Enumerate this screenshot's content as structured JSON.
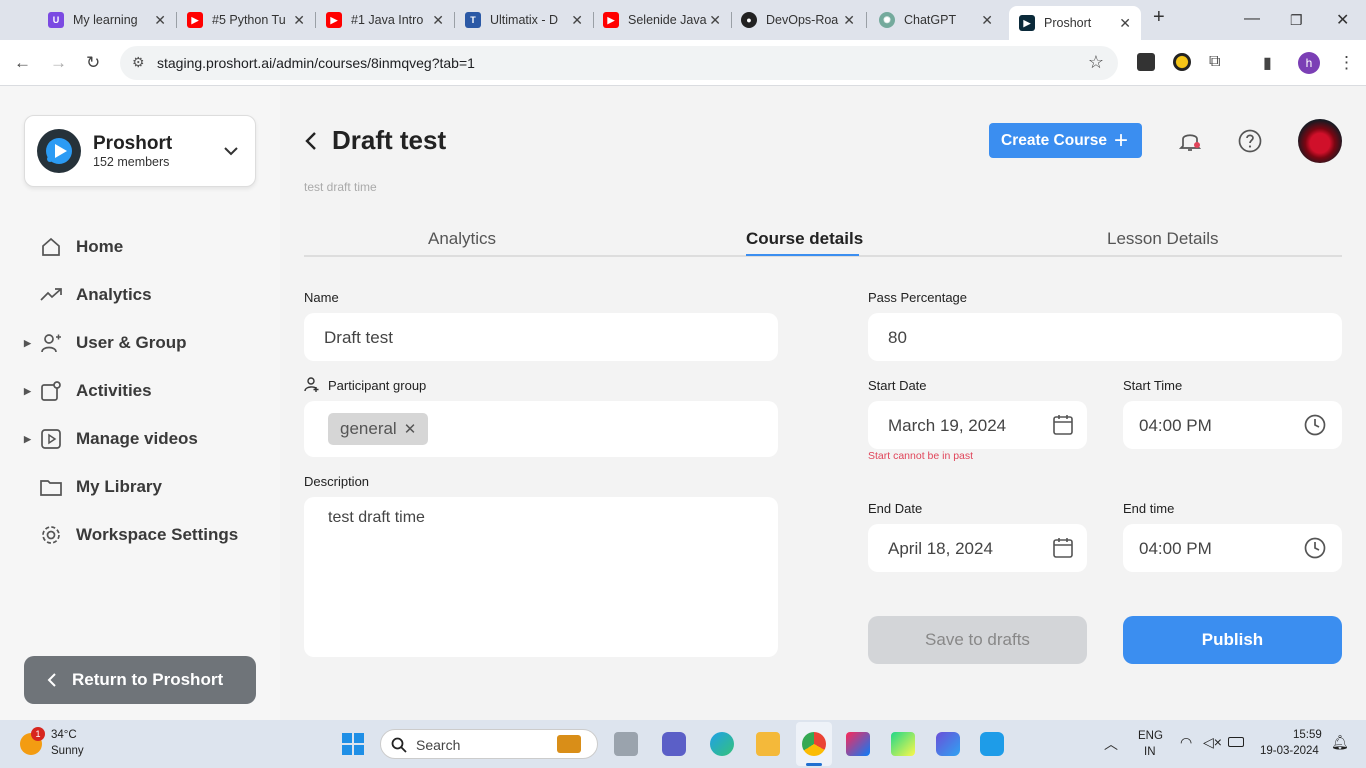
{
  "browser": {
    "tabs": [
      {
        "title": "My learning",
        "color": "#7b4ae2"
      },
      {
        "title": "#5 Python Tu",
        "color": "#ff0000"
      },
      {
        "title": "#1 Java Intro",
        "color": "#ff0000"
      },
      {
        "title": "Ultimatix - D",
        "color": "#2b59a6"
      },
      {
        "title": "Selenide Java",
        "color": "#ff0000"
      },
      {
        "title": "DevOps-Roa",
        "color": "#222222"
      },
      {
        "title": "ChatGPT",
        "color": "#74aa9c"
      },
      {
        "title": "Proshort",
        "color": "#0b2a3a"
      }
    ],
    "url": "staging.proshort.ai/admin/courses/8inmqveg?tab=1",
    "profile_initial": "h"
  },
  "sidebar": {
    "workspace_name": "Proshort",
    "workspace_members": "152 members",
    "items": [
      {
        "label": "Home",
        "icon": "home-icon",
        "expandable": false
      },
      {
        "label": "Analytics",
        "icon": "trend-icon",
        "expandable": false
      },
      {
        "label": "User & Group",
        "icon": "user-add-icon",
        "expandable": true
      },
      {
        "label": "Activities",
        "icon": "activities-icon",
        "expandable": true
      },
      {
        "label": "Manage videos",
        "icon": "video-icon",
        "expandable": true
      },
      {
        "label": "My Library",
        "icon": "folder-icon",
        "expandable": false
      },
      {
        "label": "Workspace Settings",
        "icon": "gear-icon",
        "expandable": false
      }
    ],
    "return_label": "Return to Proshort"
  },
  "header": {
    "title": "Draft test",
    "subtitle": "test draft time",
    "create_label": "Create Course"
  },
  "tabs": [
    "Analytics",
    "Course details",
    "Lesson Details"
  ],
  "form": {
    "name_label": "Name",
    "name_value": "Draft test",
    "participant_label": "Participant group",
    "participant_chip": "general",
    "description_label": "Description",
    "description_value": "test draft time",
    "pass_label": "Pass Percentage",
    "pass_value": "80",
    "start_date_label": "Start Date",
    "start_date_value": "March 19, 2024",
    "start_error": "Start cannot be in past",
    "start_time_label": "Start Time",
    "start_time_value": "04:00 PM",
    "end_date_label": "End Date",
    "end_date_value": "April 18, 2024",
    "end_time_label": "End time",
    "end_time_value": "04:00 PM",
    "save_label": "Save to drafts",
    "publish_label": "Publish"
  },
  "taskbar": {
    "weather_temp": "34°C",
    "weather_desc": "Sunny",
    "weather_badge": "1",
    "search_placeholder": "Search",
    "lang": "ENG",
    "region": "IN",
    "time": "15:59",
    "date": "19-03-2024"
  },
  "colors": {
    "accent": "#3b8ef0",
    "error": "#e0455a"
  }
}
